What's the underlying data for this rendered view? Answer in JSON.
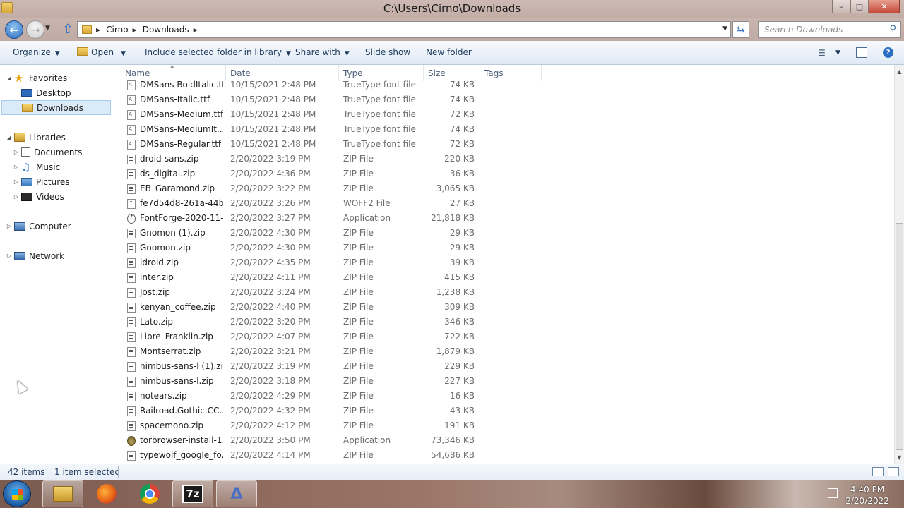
{
  "window": {
    "title": "C:\\Users\\Cirno\\Downloads"
  },
  "address": {
    "crumbs": [
      "Cirno",
      "Downloads"
    ]
  },
  "search": {
    "placeholder": "Search Downloads"
  },
  "toolbar": {
    "organize": "Organize",
    "open": "Open",
    "include_library": "Include selected folder in library",
    "share_with": "Share with",
    "slide_show": "Slide show",
    "new_folder": "New folder"
  },
  "sidebar": {
    "favorites": "Favorites",
    "desktop": "Desktop",
    "downloads": "Downloads",
    "libraries": "Libraries",
    "documents": "Documents",
    "music": "Music",
    "pictures": "Pictures",
    "videos": "Videos",
    "computer": "Computer",
    "network": "Network"
  },
  "columns": {
    "name": "Name",
    "date": "Date",
    "type": "Type",
    "size": "Size",
    "tags": "Tags"
  },
  "files": [
    {
      "name": "DMSans-BoldItalic.ttf",
      "date": "10/15/2021 2:48 PM",
      "type": "TrueType font file",
      "size": "74 KB",
      "icon": "font"
    },
    {
      "name": "DMSans-Italic.ttf",
      "date": "10/15/2021 2:48 PM",
      "type": "TrueType font file",
      "size": "74 KB",
      "icon": "font"
    },
    {
      "name": "DMSans-Medium.ttf",
      "date": "10/15/2021 2:48 PM",
      "type": "TrueType font file",
      "size": "72 KB",
      "icon": "font"
    },
    {
      "name": "DMSans-MediumIt...",
      "date": "10/15/2021 2:48 PM",
      "type": "TrueType font file",
      "size": "74 KB",
      "icon": "font"
    },
    {
      "name": "DMSans-Regular.ttf",
      "date": "10/15/2021 2:48 PM",
      "type": "TrueType font file",
      "size": "72 KB",
      "icon": "font"
    },
    {
      "name": "droid-sans.zip",
      "date": "2/20/2022 3:19 PM",
      "type": "ZIP File",
      "size": "220 KB",
      "icon": "zip"
    },
    {
      "name": "ds_digital.zip",
      "date": "2/20/2022 4:36 PM",
      "type": "ZIP File",
      "size": "36 KB",
      "icon": "zip"
    },
    {
      "name": "EB_Garamond.zip",
      "date": "2/20/2022 3:22 PM",
      "type": "ZIP File",
      "size": "3,065 KB",
      "icon": "zip"
    },
    {
      "name": "fe7d54d8-261a-44b...",
      "date": "2/20/2022 3:26 PM",
      "type": "WOFF2 File",
      "size": "27 KB",
      "icon": "woff"
    },
    {
      "name": "FontForge-2020-11-...",
      "date": "2/20/2022 3:27 PM",
      "type": "Application",
      "size": "21,818 KB",
      "icon": "ff"
    },
    {
      "name": "Gnomon (1).zip",
      "date": "2/20/2022 4:30 PM",
      "type": "ZIP File",
      "size": "29 KB",
      "icon": "zip"
    },
    {
      "name": "Gnomon.zip",
      "date": "2/20/2022 4:30 PM",
      "type": "ZIP File",
      "size": "29 KB",
      "icon": "zip"
    },
    {
      "name": "idroid.zip",
      "date": "2/20/2022 4:35 PM",
      "type": "ZIP File",
      "size": "39 KB",
      "icon": "zip"
    },
    {
      "name": "inter.zip",
      "date": "2/20/2022 4:11 PM",
      "type": "ZIP File",
      "size": "415 KB",
      "icon": "zip"
    },
    {
      "name": "Jost.zip",
      "date": "2/20/2022 3:24 PM",
      "type": "ZIP File",
      "size": "1,238 KB",
      "icon": "zip"
    },
    {
      "name": "kenyan_coffee.zip",
      "date": "2/20/2022 4:40 PM",
      "type": "ZIP File",
      "size": "309 KB",
      "icon": "zip"
    },
    {
      "name": "Lato.zip",
      "date": "2/20/2022 3:20 PM",
      "type": "ZIP File",
      "size": "346 KB",
      "icon": "zip"
    },
    {
      "name": "Libre_Franklin.zip",
      "date": "2/20/2022 4:07 PM",
      "type": "ZIP File",
      "size": "722 KB",
      "icon": "zip"
    },
    {
      "name": "Montserrat.zip",
      "date": "2/20/2022 3:21 PM",
      "type": "ZIP File",
      "size": "1,879 KB",
      "icon": "zip"
    },
    {
      "name": "nimbus-sans-l (1).zip",
      "date": "2/20/2022 3:19 PM",
      "type": "ZIP File",
      "size": "229 KB",
      "icon": "zip"
    },
    {
      "name": "nimbus-sans-l.zip",
      "date": "2/20/2022 3:18 PM",
      "type": "ZIP File",
      "size": "227 KB",
      "icon": "zip"
    },
    {
      "name": "notears.zip",
      "date": "2/20/2022 4:29 PM",
      "type": "ZIP File",
      "size": "16 KB",
      "icon": "zip"
    },
    {
      "name": "Railroad.Gothic.CC....",
      "date": "2/20/2022 4:32 PM",
      "type": "ZIP File",
      "size": "43 KB",
      "icon": "zip"
    },
    {
      "name": "spacemono.zip",
      "date": "2/20/2022 4:12 PM",
      "type": "ZIP File",
      "size": "191 KB",
      "icon": "zip"
    },
    {
      "name": "torbrowser-install-1...",
      "date": "2/20/2022 3:50 PM",
      "type": "Application",
      "size": "73,346 KB",
      "icon": "tor"
    },
    {
      "name": "typewolf_google_fo...",
      "date": "2/20/2022 4:14 PM",
      "type": "ZIP File",
      "size": "54,686 KB",
      "icon": "zip"
    }
  ],
  "status": {
    "item_count": "42 items",
    "selected": "1 item selected"
  },
  "taskbar": {
    "seven_zip_label": "7z",
    "time": "4:40 PM",
    "date": "2/20/2022"
  }
}
